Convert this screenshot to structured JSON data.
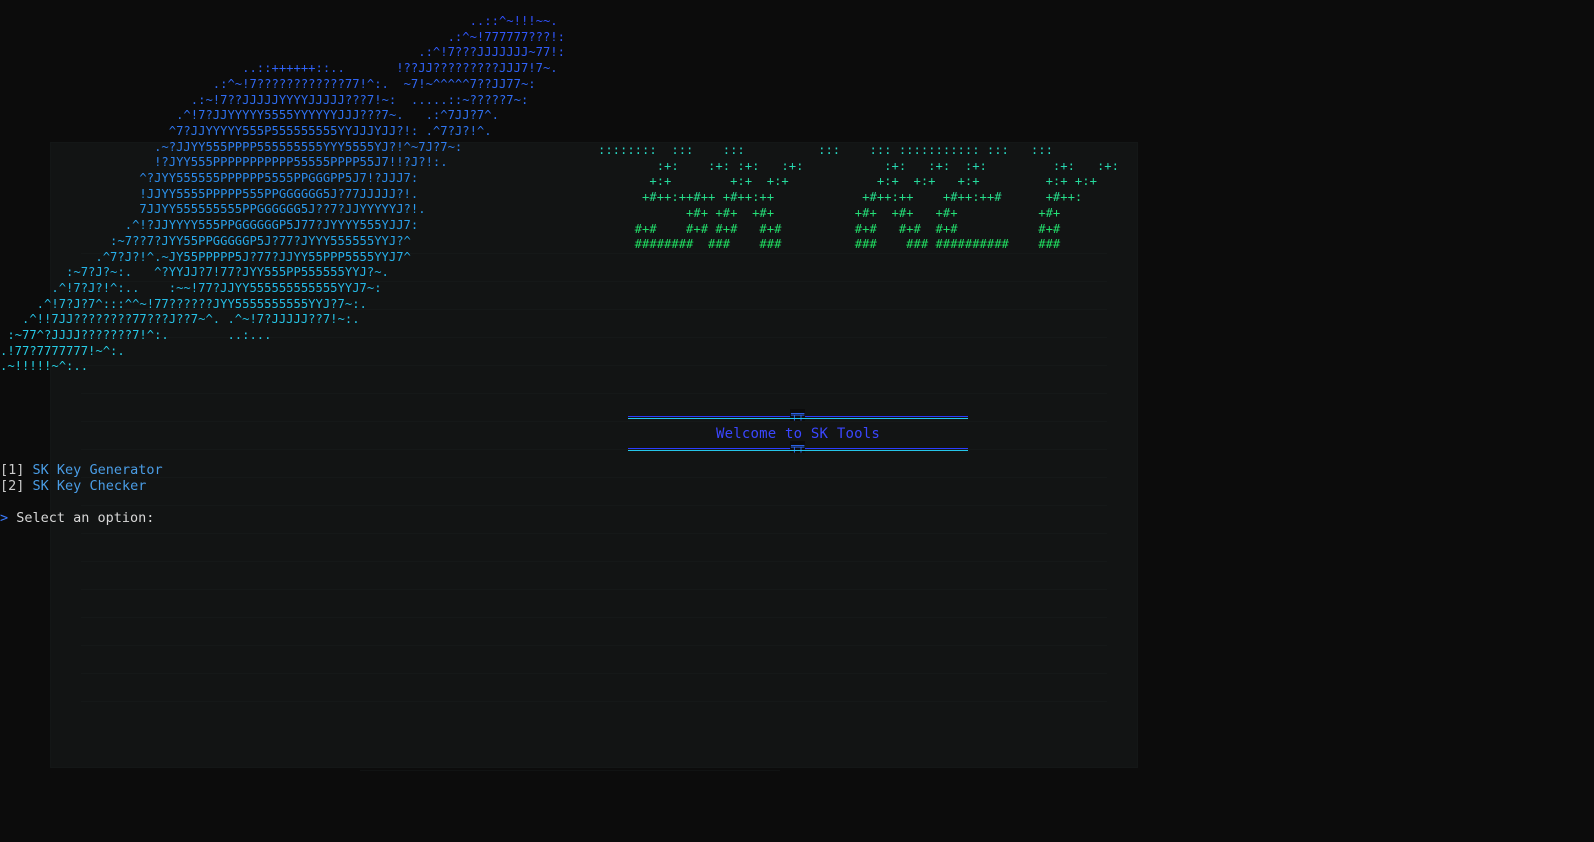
{
  "ascii_art": {
    "wolf": "                                                                ..::^~!!!~~.\n                                                             .:^~!777777???!:\n                                                         .:^!7???JJJJJJJ~77!:\n                                 ..::++++++::..       !??JJ?????????JJJ7!7~.\n                             .:^~!7????????????77!^:.  ~7!~^^^^^7??JJ77~:\n                          .:~!7??JJJJJYYYYJJJJJ???7!~:  .....::~?????7~:\n                        .^!7?JJYYYYY5555YYYYYYJJJ???7~.   .:^7JJ?7^.\n                       ^7?JJYYYYY555P555555555YYJJJYJJ?!: .^7?J?!^.\n                     .~?JJYY555PPPP555555555YYY5555YJ?!^~7J?7~:\n                     !?JYY555PPPPPPPPPPP55555PPPP55J7!!?J?!:.\n                   ^?JYY555555PPPPPP5555PPGGGPP5J7!?JJJ7:\n                   !JJYY5555PPPPP555PPGGGGGG5J?77JJJJJ?!.\n                   7JJYY555555555PPGGGGGG5J??7?JJYYYYYJ?!.\n                 .^!?JJYYYY555PPGGGGGGP5J77?JYYYY555YJJ7:\n               :~7??7?JYY55PPGGGGGP5J?77?JYYY555555YYJ?^\n             .^7?J?!^.~JY55PPPPP5J?77?JJYY55PPP5555YYJ7^\n         :~7?J?~:.   ^?YYJJ?7!77?JYY555PP555555YYJ?~.\n       .^!7?J?!^:..    :~~!77?JJYY555555555555YYJ7~:\n     .^!7?J?7^:::^^~!77??????JYY5555555555YYJ?7~:.\n   .^!!7JJ????????77???J??7~^. .^~!7?JJJJJ??7!~:.\n :~77^?JJJJ???????7!^:.        ..:...\n.!77?7777777!~^:.\n.~!!!!!~^:..",
    "title": "::::::::  :::    :::          :::    ::: ::::::::::: :::   :::\n        :+:    :+: :+:   :+:           :+:   :+:  :+:         :+:   :+:\n       +:+        +:+  +:+            +:+  +:+   +:+         +:+ +:+\n      +#++:++#++ +#++:++            +#++:++    +#++:++#      +#++:\n            +#+ +#+  +#+           +#+  +#+   +#+           +#+\n     #+#    #+# #+#   #+#          #+#   #+#  #+#           #+#\n     ########  ###    ###          ###    ### ##########    ###"
  },
  "banner": {
    "knot": "╤╤",
    "welcome": "Welcome to SK Tools"
  },
  "menu": {
    "items": [
      {
        "key": "1",
        "label": "SK Key Generator"
      },
      {
        "key": "2",
        "label": "SK Key Checker"
      }
    ]
  },
  "prompt": {
    "arrow": ">",
    "text": " Select an option:"
  },
  "colors": {
    "background": "#0c0c0c",
    "wolf_gradient_top": "#3050ff",
    "wolf_gradient_bottom": "#27d6e6",
    "title_gradient_top": "#28d7d0",
    "title_gradient_bottom": "#1fe05a",
    "welcome_text": "#3a46ff",
    "menu_label": "#4a9de6",
    "prompt_arrow": "#3b7bff"
  }
}
